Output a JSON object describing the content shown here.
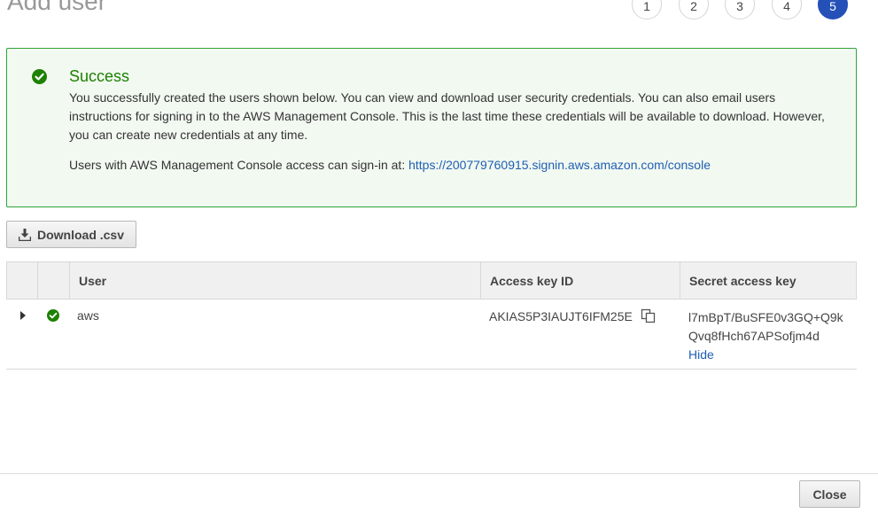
{
  "page": {
    "title": "Add user"
  },
  "steps": [
    "1",
    "2",
    "3",
    "4",
    "5"
  ],
  "alert": {
    "title": "Success",
    "body": "You successfully created the users shown below. You can view and download user security credentials. You can also email users instructions for signing in to the AWS Management Console. This is the last time these credentials will be available to download. However, you can create new credentials at any time.",
    "console_text": "Users with AWS Management Console access can sign-in at: ",
    "console_link": "https://200779760915.signin.aws.amazon.com/console",
    "color": "#1d8102"
  },
  "toolbar": {
    "download_label": "Download .csv",
    "download_icon": "download-icon"
  },
  "table": {
    "headers": [
      "",
      "",
      "User",
      "Access key ID",
      "Secret access key"
    ],
    "rows": [
      {
        "user": "aws",
        "access_key_id": "AKIAS5P3IAUJT6IFM25E",
        "secret_line1": "l7mBpT/BuSFE0v3GQ+Q9k",
        "secret_line2": "Qvq8fHch67APSofjm4d",
        "hide_label": "Hide"
      }
    ]
  },
  "footer": {
    "close_label": "Close"
  },
  "colors": {
    "accent": "#2450b8",
    "success": "#1d8102",
    "link": "#1f5fb3"
  }
}
